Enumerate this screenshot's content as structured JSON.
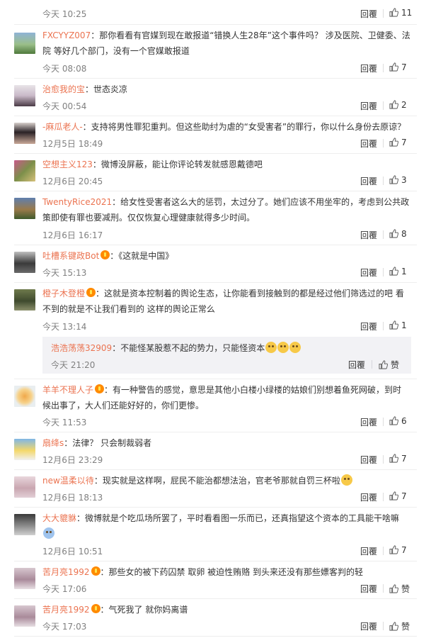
{
  "first": {
    "time": "今天 10:25",
    "reply": "回覆",
    "likes": "11"
  },
  "comments": [
    {
      "user": "FXCYYZ007",
      "line1": "：那你看看有官媒到现在敢报道“错换人生28年”这个事件吗？ 涉及医院、卫健委、法",
      "line2": "院 等好几个部门，没有一个官媒敢报道",
      "time": "今天 08:08",
      "reply": "回覆",
      "likes": "7"
    },
    {
      "user": "治愈我的宝",
      "line1": "：世态炎凉",
      "time": "今天 00:54",
      "reply": "回覆",
      "likes": "2"
    },
    {
      "user": "-麻瓜老人-",
      "line1": "：支持将男性罪犯重判。但这些助纣为虐的“女受害者”的罪行，你以什么身份去原谅？",
      "time": "12月5日 18:49",
      "reply": "回覆",
      "likes": "7"
    },
    {
      "user": "空想主义123",
      "line1": "：微博没屏蔽，能让你评论转发就感恩戴德吧",
      "time": "12月6日 20:45",
      "reply": "回覆",
      "likes": "3"
    },
    {
      "user": "TwentyRice2021",
      "line1": "：给女性受害者这么大的惩罚，太过分了。她们应该不用坐牢的，考虑到公共政",
      "line2": "策即使有罪也要减刑。仅仅恢复心理健康就得多少时间。",
      "time": "12月6日 16:17",
      "reply": "回覆",
      "likes": "8"
    },
    {
      "user": "吐槽系键政Bot",
      "line1": "：《这就是中国》",
      "time": "今天 15:13",
      "reply": "回覆",
      "likes": "1"
    },
    {
      "user": "橙子木登橙",
      "line1": "：这就是资本控制着的舆论生态，让你能看到接触到的都是经过他们筛选过的吧 看",
      "line2": "不到的就是不让我们看到的 这样的舆论正常么",
      "time": "今天 13:14",
      "reply": "回覆",
      "likes": "1"
    },
    {
      "user": "羊羊不理人子",
      "line1": "：有一种警告的感觉，意思是其他小白楼小绿楼的姑娘们别想着鱼死网破，到时",
      "line2": "候出事了，大人们还能好好的，你们更惨。",
      "time": "今天 11:53",
      "reply": "回覆",
      "likes": "6"
    },
    {
      "user": "扇绛s",
      "line1": "：法律？ 只会制裁弱者",
      "time": "12月6日 23:29",
      "reply": "回覆",
      "likes": "7"
    },
    {
      "user": "new温柔以待",
      "line1": "：现实就是这样啊，屁民不能治都想法治，官老爷那就自罚三杯啦",
      "time": "12月6日 18:13",
      "reply": "回覆",
      "likes": "7"
    },
    {
      "user": "大大貔貅",
      "line1": "：微博就是个吃瓜场所罢了，平时看看图一乐而已，还真指望这个资本的工具能干啥嘛",
      "time": "12月6日 10:51",
      "reply": "回覆",
      "likes": "7"
    },
    {
      "user": "苦月亮1992",
      "line1": "：那些女的被下药囚禁 取卵 被迫性贿赂  到头来还没有那些嫖客判的轻",
      "time": "今天 17:06",
      "reply": "回覆",
      "likes": "赞"
    },
    {
      "user": "苦月亮1992",
      "line1": "：气死我了 就你妈离谱",
      "time": "今天 17:03",
      "reply": "回覆",
      "likes": "赞"
    }
  ],
  "subreply": {
    "user": "浩浩荡荡32909",
    "text": "：不能怪某股惹不起的势力，只能怪资本",
    "time": "今天 21:20",
    "reply": "回覆",
    "likes": "赞"
  },
  "colors": {
    "username": "#eb7350",
    "text": "#333333",
    "meta": "#808080",
    "subbox": "#f2f2f5"
  }
}
